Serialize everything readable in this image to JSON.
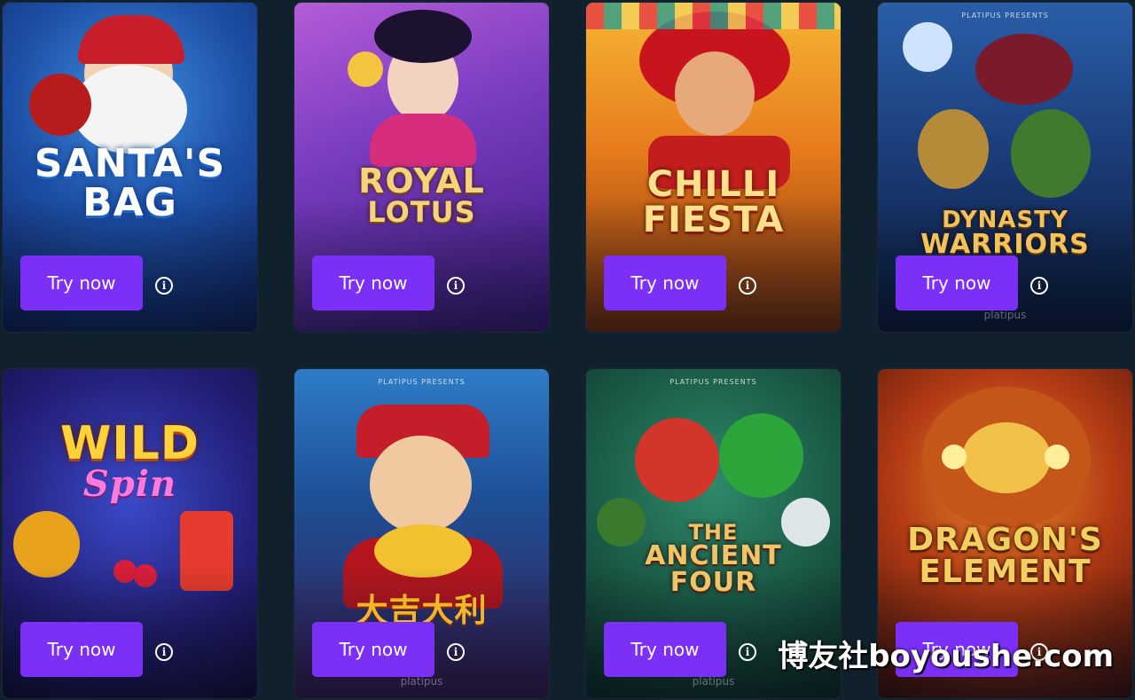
{
  "cards": [
    {
      "title_lines": [
        "SANTA'S",
        "BAG"
      ],
      "button_label": "Try now",
      "info_icon": "info-icon",
      "presents": "",
      "brand": ""
    },
    {
      "title_lines": [
        "ROYAL",
        "LOTUS"
      ],
      "button_label": "Try now",
      "info_icon": "info-icon",
      "presents": "",
      "brand": ""
    },
    {
      "title_lines": [
        "CHILLI",
        "FIESTA"
      ],
      "button_label": "Try now",
      "info_icon": "info-icon",
      "presents": "",
      "brand": ""
    },
    {
      "title_lines": [
        "DYNASTY",
        "WARRIORS"
      ],
      "button_label": "Try now",
      "info_icon": "info-icon",
      "presents": "PLATIPUS PRESENTS",
      "brand": "platipus"
    },
    {
      "title_lines": [
        "WILD",
        "Spin"
      ],
      "button_label": "Try now",
      "info_icon": "info-icon",
      "presents": "",
      "brand": ""
    },
    {
      "title_lines": [
        "大吉大利"
      ],
      "button_label": "Try now",
      "info_icon": "info-icon",
      "presents": "PLATIPUS PRESENTS",
      "brand": "platipus"
    },
    {
      "title_lines": [
        "THE",
        "ANCIENT",
        "FOUR"
      ],
      "button_label": "Try now",
      "info_icon": "info-icon",
      "presents": "PLATIPUS PRESENTS",
      "brand": "platipus"
    },
    {
      "title_lines": [
        "DRAGON'S",
        "ELEMENT"
      ],
      "button_label": "Try now",
      "info_icon": "info-icon",
      "presents": "",
      "brand": ""
    }
  ],
  "watermark": "博友社boyoushe.com",
  "colors": {
    "background": "#10202c",
    "button": "#7b2ff7",
    "button_text": "#ffffff"
  }
}
